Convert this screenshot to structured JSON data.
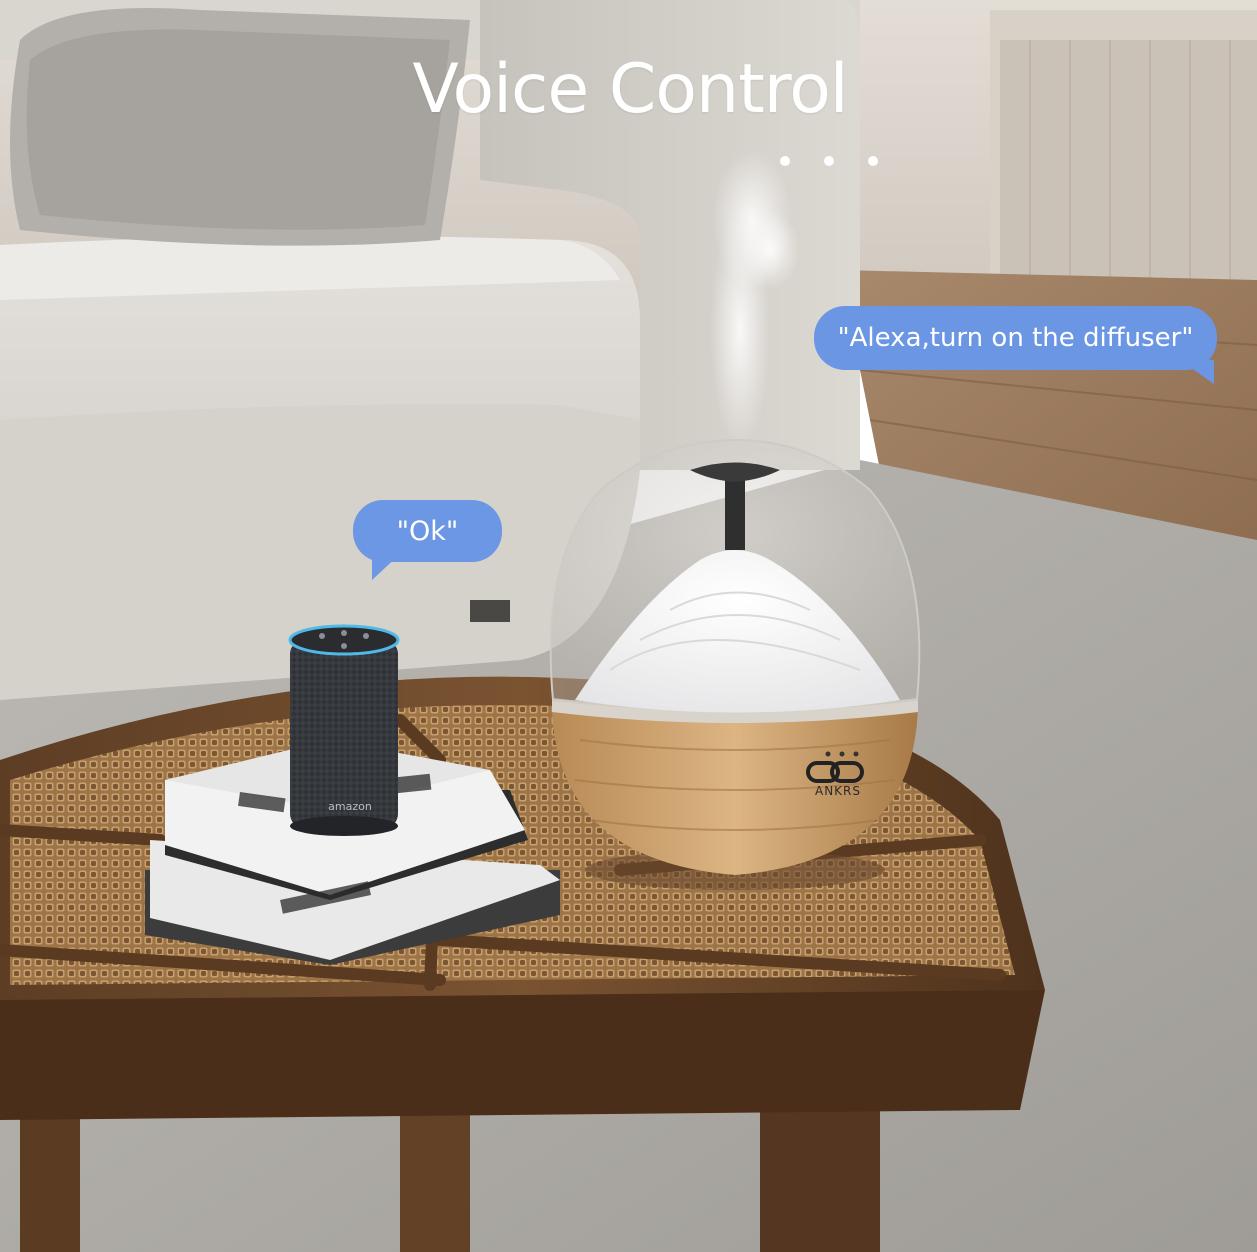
{
  "headline": "Voice Control",
  "bubbles": {
    "speaker_reply": "\"Ok\"",
    "voice_command": "\"Alexa,turn on the diffuser\""
  },
  "product_labels": {
    "speaker_brand": "amazon",
    "diffuser_brand": "ANKRS"
  },
  "colors": {
    "bubble_blue": "#6b96e3",
    "headline_white": "#ffffff",
    "wood": "#6e4a2c",
    "rattan": "#a67c4e"
  }
}
